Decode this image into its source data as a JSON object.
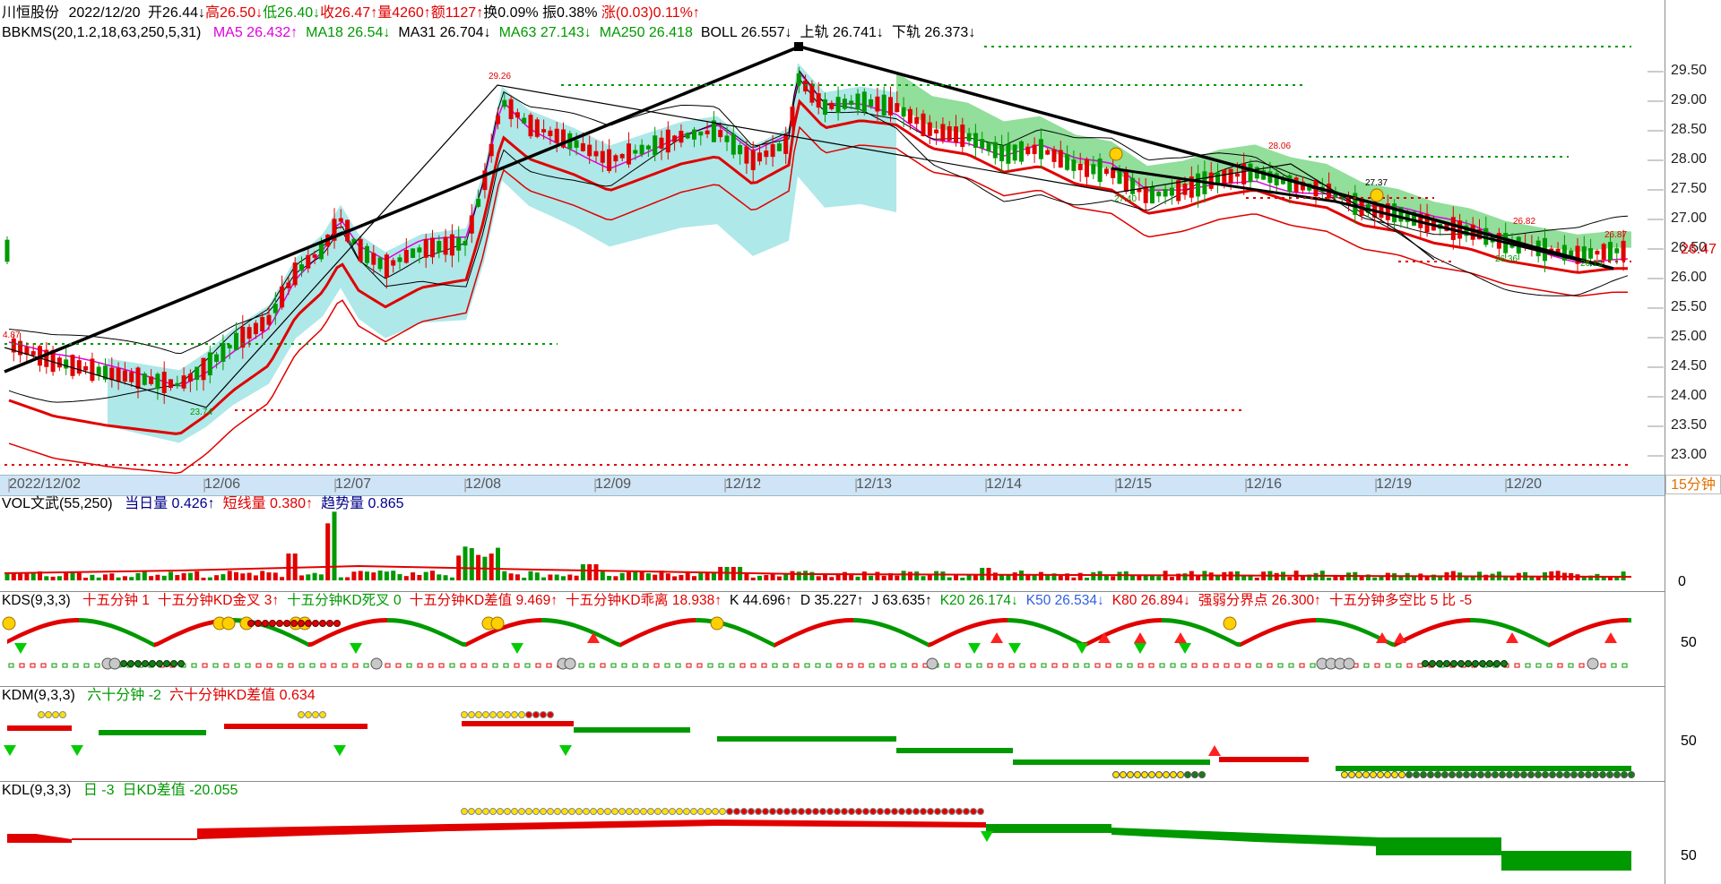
{
  "stock": {
    "name": "川恒股份",
    "date": "2022/12/20"
  },
  "quote": [
    {
      "label": "开26.44",
      "arrow": "↓",
      "color": "#000000"
    },
    {
      "label": "高26.50",
      "arrow": "↓",
      "color": "#e00000"
    },
    {
      "label": "低26.40",
      "arrow": "↓",
      "color": "#009900"
    },
    {
      "label": "收26.47",
      "arrow": "↑",
      "color": "#e00000"
    },
    {
      "label": "量4260",
      "arrow": "↑",
      "color": "#e00000"
    },
    {
      "label": "额1127",
      "arrow": "↑",
      "color": "#e00000"
    },
    {
      "label": "换0.09%",
      "arrow": "",
      "color": "#000000"
    },
    {
      "label": "振0.38%",
      "arrow": "",
      "color": "#000000"
    },
    {
      "label": "涨(0.03)0.11%",
      "arrow": "↑",
      "color": "#e00000"
    }
  ],
  "main_indicator": {
    "name": "BBKMS(20,1.2,18,63,250,5,31)",
    "items": [
      {
        "text": "MA5 26.432↑",
        "color": "#e000e0"
      },
      {
        "text": "MA18 26.54↓",
        "color": "#009900"
      },
      {
        "text": "MA31 26.704↓",
        "color": "#000000"
      },
      {
        "text": "MA63 27.143↓",
        "color": "#009900"
      },
      {
        "text": "MA250 26.418",
        "color": "#009900"
      },
      {
        "text": "BOLL 26.557↓",
        "color": "#000000"
      },
      {
        "text": "上轨 26.741↓",
        "color": "#000000"
      },
      {
        "text": "下轨 26.373↓",
        "color": "#000000"
      }
    ]
  },
  "price_axis": [
    "29.50",
    "29.00",
    "28.50",
    "28.00",
    "27.50",
    "27.00",
    "26.50",
    "26.00",
    "25.50",
    "25.00",
    "24.50",
    "24.00",
    "23.50",
    "23.00"
  ],
  "last_price": "26.47",
  "chart_marks": {
    "high": "29.26",
    "left": "4.87",
    "low": "23.74",
    "m1": "28.06",
    "m2": "27.37",
    "m3": "27.40",
    "m4": "26.36",
    "m5": "26.82",
    "m6": "26.87",
    "m7": "26.15"
  },
  "dates": [
    "2022/12/02",
    "12/06",
    "12/07",
    "12/08",
    "12/09",
    "12/12",
    "12/13",
    "12/14",
    "12/15",
    "12/16",
    "12/19",
    "12/20"
  ],
  "period": "15分钟",
  "vol": {
    "name": "VOL文武(55,250)",
    "items": [
      {
        "text": "当日量 0.426↑",
        "color": "#00008b"
      },
      {
        "text": "短线量 0.380↑",
        "color": "#e00000"
      },
      {
        "text": "趋势量 0.865",
        "color": "#00008b"
      }
    ],
    "axis": "0"
  },
  "kds": {
    "name": "KDS(9,3,3)",
    "items": [
      {
        "text": "十五分钟 1",
        "color": "#e00000"
      },
      {
        "text": "十五分钟KD金叉 3↑",
        "color": "#e00000"
      },
      {
        "text": "十五分钟KD死叉 0",
        "color": "#009900"
      },
      {
        "text": "十五分钟KD差值 9.469↑",
        "color": "#e00000"
      },
      {
        "text": "十五分钟KD乖离 18.938↑",
        "color": "#e00000"
      },
      {
        "text": "K 44.696↑",
        "color": "#000000"
      },
      {
        "text": "D 35.227↑",
        "color": "#000000"
      },
      {
        "text": "J 63.635↑",
        "color": "#000000"
      },
      {
        "text": "K20 26.174↓",
        "color": "#009900"
      },
      {
        "text": "K50 26.534↓",
        "color": "#3060e0"
      },
      {
        "text": "K80 26.894↓",
        "color": "#e00000"
      },
      {
        "text": "强弱分界点 26.300↑",
        "color": "#e00000"
      },
      {
        "text": "十五分钟多空比 5  比 -5",
        "color": "#e00000"
      }
    ],
    "axis": "50"
  },
  "kdm": {
    "name": "KDM(9,3,3)",
    "items": [
      {
        "text": "六十分钟 -2",
        "color": "#009900"
      },
      {
        "text": "六十分钟KD差值 0.634",
        "color": "#e00000"
      }
    ],
    "axis": "50"
  },
  "kdl": {
    "name": "KDL(9,3,3)",
    "items": [
      {
        "text": "日 -3",
        "color": "#009900"
      },
      {
        "text": "日KD差值 -20.055",
        "color": "#009900"
      }
    ],
    "axis": "50"
  },
  "colors": {
    "up": "#e00000",
    "down": "#009900",
    "band": "#aee8e8",
    "band_green": "#7fd88a",
    "grid": "#c8c8c8"
  }
}
